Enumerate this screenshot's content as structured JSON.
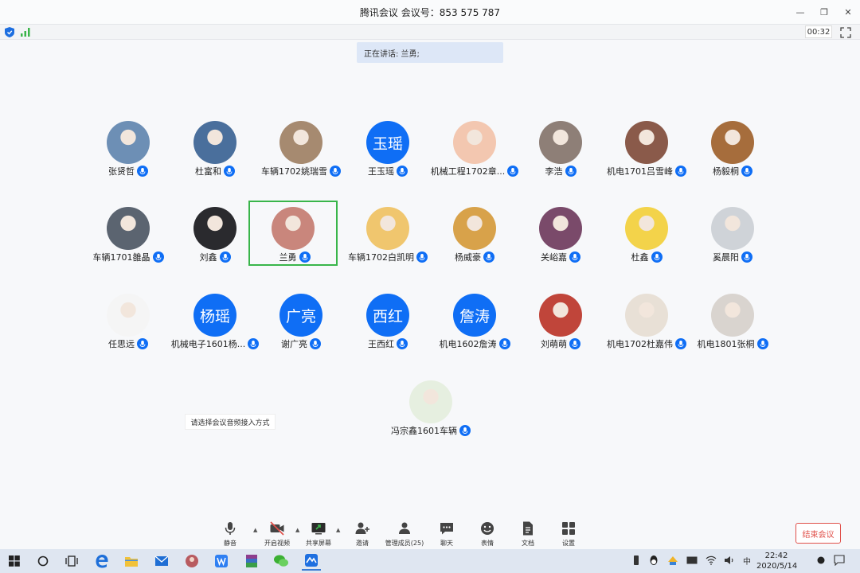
{
  "window": {
    "title": "腾讯会议 会议号：853 575 787",
    "timer": "00:32"
  },
  "speaking": "正在讲话: 兰勇;",
  "participants": [
    {
      "name": "张贤哲",
      "avatar_type": "photo",
      "color": "#6d8fb5"
    },
    {
      "name": "杜富和",
      "avatar_type": "photo",
      "color": "#4a6f9c"
    },
    {
      "name": "车辆1702姚瑞雪",
      "avatar_type": "photo",
      "color": "#a68a70"
    },
    {
      "name": "王玉瑶",
      "avatar_type": "text",
      "avatar_text": "玉瑶"
    },
    {
      "name": "机械工程1702章...",
      "avatar_type": "photo",
      "color": "#f3c7b0"
    },
    {
      "name": "李浩",
      "avatar_type": "photo",
      "color": "#8e7f77"
    },
    {
      "name": "机电1701吕雪峰",
      "avatar_type": "photo",
      "color": "#8a5a4a"
    },
    {
      "name": "杨毅桐",
      "avatar_type": "photo",
      "color": "#a66d3c"
    },
    {
      "name": "车辆1701雒晶",
      "avatar_type": "photo",
      "color": "#5b6470"
    },
    {
      "name": "刘鑫",
      "avatar_type": "photo",
      "color": "#2a2a2e"
    },
    {
      "name": "兰勇",
      "avatar_type": "photo",
      "color": "#c9867c"
    },
    {
      "name": "车辆1702白凯明",
      "avatar_type": "photo",
      "color": "#f0c66e"
    },
    {
      "name": "杨威豪",
      "avatar_type": "photo",
      "color": "#d8a24a"
    },
    {
      "name": "关峪嘉",
      "avatar_type": "photo",
      "color": "#7a4a6a"
    },
    {
      "name": "杜鑫",
      "avatar_type": "photo",
      "color": "#f3d34a"
    },
    {
      "name": "奚晨阳",
      "avatar_type": "photo",
      "color": "#cfd3d8"
    },
    {
      "name": "任思远",
      "avatar_type": "photo",
      "color": "#f5f5f5"
    },
    {
      "name": "机械电子1601杨...",
      "avatar_type": "text",
      "avatar_text": "杨瑶"
    },
    {
      "name": "谢广亮",
      "avatar_type": "text",
      "avatar_text": "广亮"
    },
    {
      "name": "王西红",
      "avatar_type": "text",
      "avatar_text": "西红"
    },
    {
      "name": "机电1602詹涛",
      "avatar_type": "text",
      "avatar_text": "詹涛"
    },
    {
      "name": "刘萌萌",
      "avatar_type": "photo",
      "color": "#c0453a"
    },
    {
      "name": "机电1702杜嘉伟",
      "avatar_type": "photo",
      "color": "#e8e0d6"
    },
    {
      "name": "机电1801张桐",
      "avatar_type": "photo",
      "color": "#d9d4cf"
    },
    {
      "name": "冯宗鑫1601车辆",
      "avatar_type": "photo",
      "color": "#e6efe0"
    }
  ],
  "audio_tip": "请选择会议音频接入方式",
  "toolbar": {
    "mute": "静音",
    "video": "开启视频",
    "share": "共享屏幕",
    "invite": "邀请",
    "members": "管理成员(25)",
    "chat": "聊天",
    "emoji": "表情",
    "docs": "文档",
    "settings": "设置"
  },
  "end_meeting": "结束会议",
  "taskbar": {
    "time": "22:42",
    "date": "2020/5/14",
    "ime": "中"
  },
  "colors": {
    "accent": "#0f6ef5",
    "active_speaker": "#39b54a",
    "end": "#e0504a"
  }
}
